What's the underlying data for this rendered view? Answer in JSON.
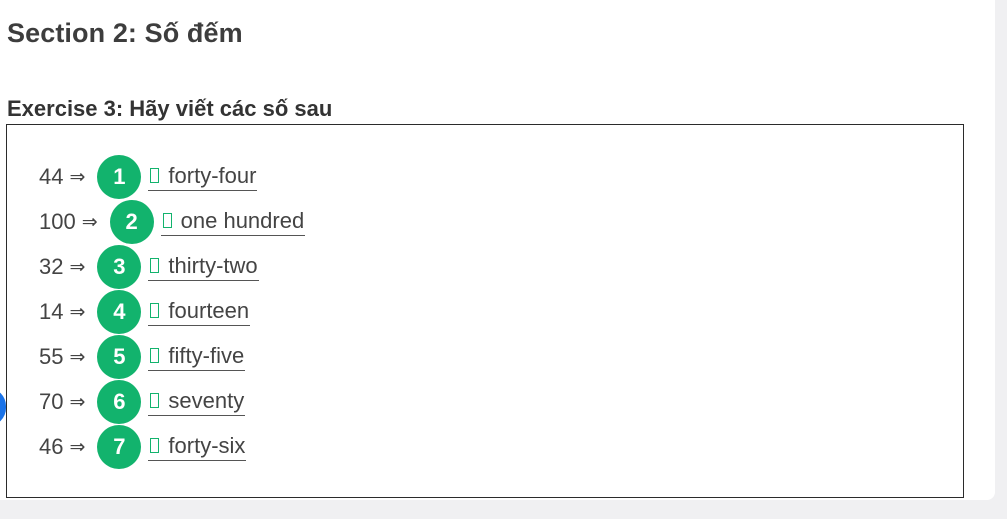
{
  "section": {
    "title": "Section 2: Số đếm"
  },
  "exercise": {
    "title": "Exercise 3: Hãy viết các số sau"
  },
  "items": [
    {
      "number": "44",
      "arrow": "⇒",
      "badge": "1",
      "answer": "forty-four"
    },
    {
      "number": "100",
      "arrow": "⇒",
      "badge": "2",
      "answer": "one hundred"
    },
    {
      "number": "32",
      "arrow": "⇒",
      "badge": "3",
      "answer": "thirty-two"
    },
    {
      "number": "14",
      "arrow": "⇒",
      "badge": "4",
      "answer": "fourteen"
    },
    {
      "number": "55",
      "arrow": "⇒",
      "badge": "5",
      "answer": "fifty-five"
    },
    {
      "number": "70",
      "arrow": "⇒",
      "badge": "6",
      "answer": "seventy"
    },
    {
      "number": "46",
      "arrow": "⇒",
      "badge": "7",
      "answer": "forty-six"
    }
  ],
  "colors": {
    "badge": "#12b36d",
    "accent_dot": "#1a73e8",
    "border": "#2b2b2b",
    "background": "#f0f0f2"
  },
  "icons": {
    "answer_marker": "missing-glyph-box-icon",
    "side_handle": "blue-dot-icon"
  }
}
